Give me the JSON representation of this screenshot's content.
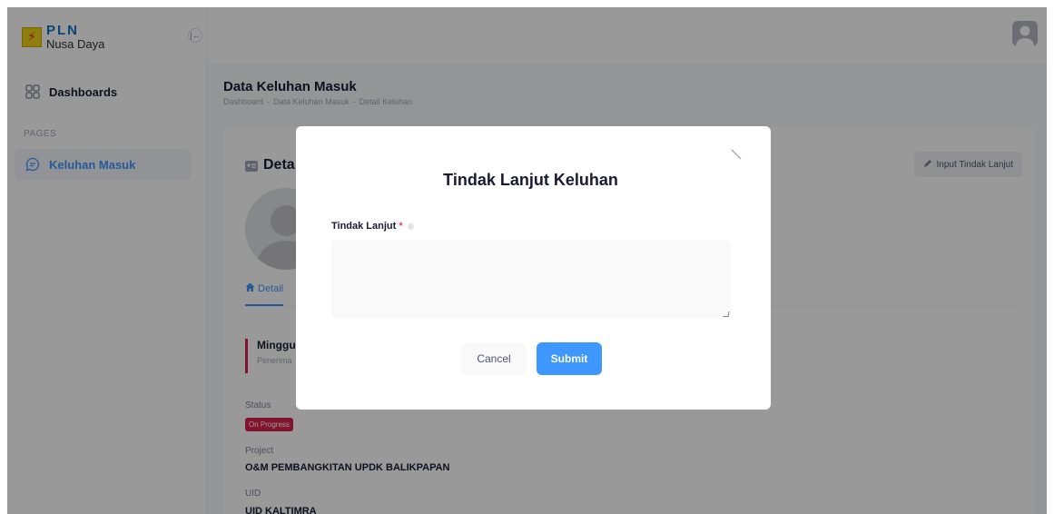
{
  "brand": {
    "name": "PLN",
    "subtitle": "Nusa Daya",
    "collapse_icon": "arrow-collapse-icon"
  },
  "sidebar": {
    "section_label": "PAGES",
    "items": [
      {
        "label": "Dashboards",
        "icon": "grid-icon"
      },
      {
        "label": "Keluhan Masuk",
        "icon": "chat-icon"
      }
    ]
  },
  "header": {
    "avatar": "user-avatar"
  },
  "page": {
    "title": "Data Keluhan Masuk",
    "breadcrumb": [
      "Dashboard",
      "-",
      "Data Keluhan Masuk",
      "-",
      "Detail Keluhan"
    ]
  },
  "card": {
    "title": "Deta",
    "action_label": "Input Tindak Lanjut",
    "tab_label": "Detail",
    "date_main": "Minggu",
    "date_sub": "Penerima",
    "status_label": "Status",
    "status_value": "On Progress",
    "project_label": "Project",
    "project_value": "O&M PEMBANGKITAN UPDK BALIKPAPAN",
    "uid_label": "UID",
    "uid_value": "UID KALTIMRA"
  },
  "modal": {
    "title": "Tindak Lanjut Keluhan",
    "field_label": "Tindak Lanjut",
    "required_mark": "*",
    "textarea_value": "",
    "cancel_label": "Cancel",
    "submit_label": "Submit"
  },
  "colors": {
    "accent": "#3e97ff",
    "danger": "#d9214e",
    "overlay": "rgba(0,0,0,0.4)"
  }
}
